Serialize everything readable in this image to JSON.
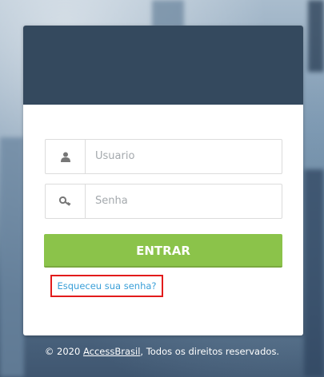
{
  "form": {
    "username_placeholder": "Usuario",
    "password_placeholder": "Senha",
    "submit_label": "ENTRAR",
    "forgot_link": "Esqueceu sua senha?"
  },
  "footer": {
    "prefix": "© 2020 ",
    "brand": "AccessBrasil",
    "suffix": ", Todos os direitos reservados."
  },
  "colors": {
    "header": "#34495e",
    "button": "#8bc34a",
    "link": "#3a9fd8",
    "highlight": "#e21b1b"
  },
  "icons": {
    "username": "user-icon",
    "password": "key-icon"
  }
}
